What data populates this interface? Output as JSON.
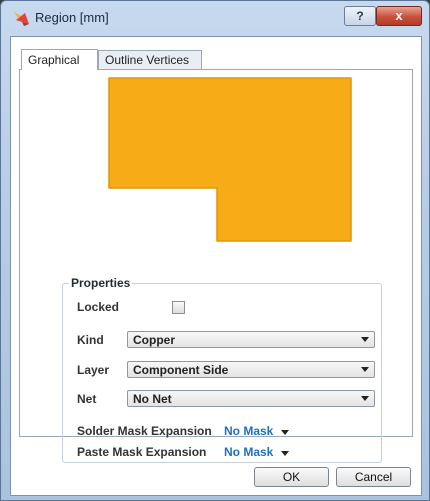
{
  "window": {
    "title": "Region [mm]",
    "help_label": "?",
    "close_label": "x"
  },
  "tabs": [
    {
      "label": "Graphical",
      "active": true
    },
    {
      "label": "Outline Vertices",
      "active": false
    }
  ],
  "region_preview": {
    "fill_color": "#f7ac17",
    "stroke_color": "#e4940a"
  },
  "properties": {
    "title": "Properties",
    "locked": {
      "label": "Locked",
      "checked": false
    },
    "kind": {
      "label": "Kind",
      "value": "Copper"
    },
    "layer": {
      "label": "Layer",
      "value": "Component Side"
    },
    "net": {
      "label": "Net",
      "value": "No Net"
    },
    "solder_mask": {
      "label": "Solder Mask Expansion",
      "value": "No Mask"
    },
    "paste_mask": {
      "label": "Paste Mask Expansion",
      "value": "No Mask"
    }
  },
  "buttons": {
    "ok": "OK",
    "cancel": "Cancel"
  },
  "colors": {
    "link": "#1f6fc4",
    "titlebar": "#b6cde6",
    "close": "#c9503c"
  }
}
